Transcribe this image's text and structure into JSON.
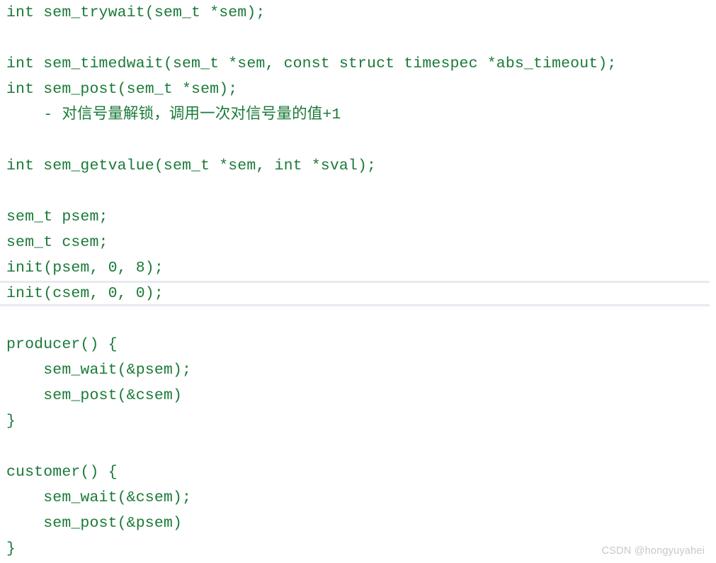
{
  "document": {
    "type": "code-notes",
    "language": "c",
    "background_color": "#ffffff",
    "code_color": "#1a7a38",
    "highlight_border_color": "#e9e9f2",
    "lines": [
      {
        "id": "l1",
        "text": "int sem_trywait(sem_t *sem);",
        "blank": false,
        "highlight": false
      },
      {
        "id": "l2",
        "text": "",
        "blank": true,
        "highlight": false
      },
      {
        "id": "l3",
        "text": "int sem_timedwait(sem_t *sem, const struct timespec *abs_timeout);",
        "blank": false,
        "highlight": false
      },
      {
        "id": "l4",
        "text": "int sem_post(sem_t *sem);",
        "blank": false,
        "highlight": false
      },
      {
        "id": "l5",
        "text": "    - 对信号量解锁，调用一次对信号量的值+1",
        "blank": false,
        "highlight": false
      },
      {
        "id": "l6",
        "text": "",
        "blank": true,
        "highlight": false
      },
      {
        "id": "l7",
        "text": "int sem_getvalue(sem_t *sem, int *sval);",
        "blank": false,
        "highlight": false
      },
      {
        "id": "l8",
        "text": "",
        "blank": true,
        "highlight": false
      },
      {
        "id": "l9",
        "text": "sem_t psem;",
        "blank": false,
        "highlight": false
      },
      {
        "id": "l10",
        "text": "sem_t csem;",
        "blank": false,
        "highlight": false
      },
      {
        "id": "l11",
        "text": "init(psem, 0, 8);",
        "blank": false,
        "highlight": false
      },
      {
        "id": "l12",
        "text": "init(csem, 0, 0);",
        "blank": false,
        "highlight": true
      },
      {
        "id": "l13",
        "text": "",
        "blank": true,
        "highlight": false
      },
      {
        "id": "l14",
        "text": "producer() {",
        "blank": false,
        "highlight": false
      },
      {
        "id": "l15",
        "text": "    sem_wait(&psem);",
        "blank": false,
        "highlight": false
      },
      {
        "id": "l16",
        "text": "    sem_post(&csem)",
        "blank": false,
        "highlight": false
      },
      {
        "id": "l17",
        "text": "}",
        "blank": false,
        "highlight": false
      },
      {
        "id": "l18",
        "text": "",
        "blank": true,
        "highlight": false
      },
      {
        "id": "l19",
        "text": "customer() {",
        "blank": false,
        "highlight": false
      },
      {
        "id": "l20",
        "text": "    sem_wait(&csem);",
        "blank": false,
        "highlight": false
      },
      {
        "id": "l21",
        "text": "    sem_post(&psem)",
        "blank": false,
        "highlight": false
      },
      {
        "id": "l22",
        "text": "}",
        "blank": false,
        "highlight": false
      }
    ]
  },
  "watermark": {
    "text": "CSDN @hongyuyahei",
    "color": "#c8c8c8"
  }
}
